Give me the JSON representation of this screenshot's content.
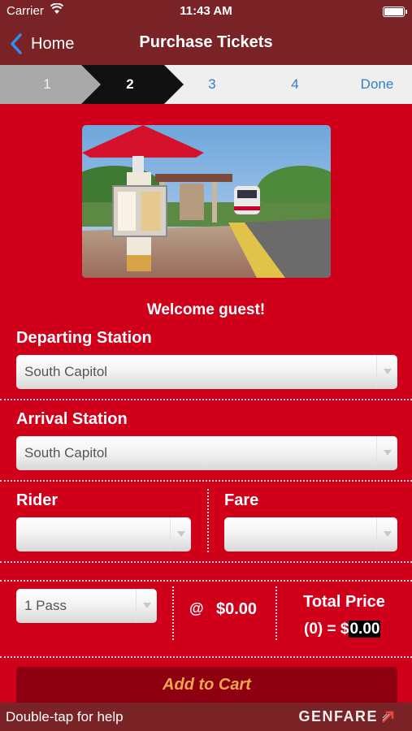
{
  "status_bar": {
    "carrier": "Carrier",
    "time": "11:43 AM"
  },
  "nav": {
    "back_label": "Home",
    "title": "Purchase Tickets"
  },
  "steps": [
    {
      "label": "1",
      "state": "completed"
    },
    {
      "label": "2",
      "state": "current"
    },
    {
      "label": "3",
      "state": "upcoming"
    },
    {
      "label": "4",
      "state": "upcoming"
    },
    {
      "label": "Done",
      "state": "upcoming"
    }
  ],
  "welcome": "Welcome guest!",
  "departing": {
    "label": "Departing Station",
    "value": "South Capitol"
  },
  "arrival": {
    "label": "Arrival Station",
    "value": "South Capitol"
  },
  "rider": {
    "label": "Rider",
    "value": ""
  },
  "fare": {
    "label": "Fare",
    "value": ""
  },
  "quantity": {
    "value": "1 Pass"
  },
  "pricing": {
    "at": "@",
    "unit_price": "$0.00",
    "total_label": "Total Price",
    "count": "(0)",
    "equals": "=",
    "total_currency": "$",
    "total_amount": "0.00"
  },
  "add_to_cart": "Add to Cart",
  "footer": {
    "help": "Double-tap for help",
    "brand": "GENFARE"
  },
  "colors": {
    "brand_red": "#d0001b",
    "header": "#7a2326",
    "link_blue": "#2f80c8",
    "button_text": "#f2a64f"
  }
}
